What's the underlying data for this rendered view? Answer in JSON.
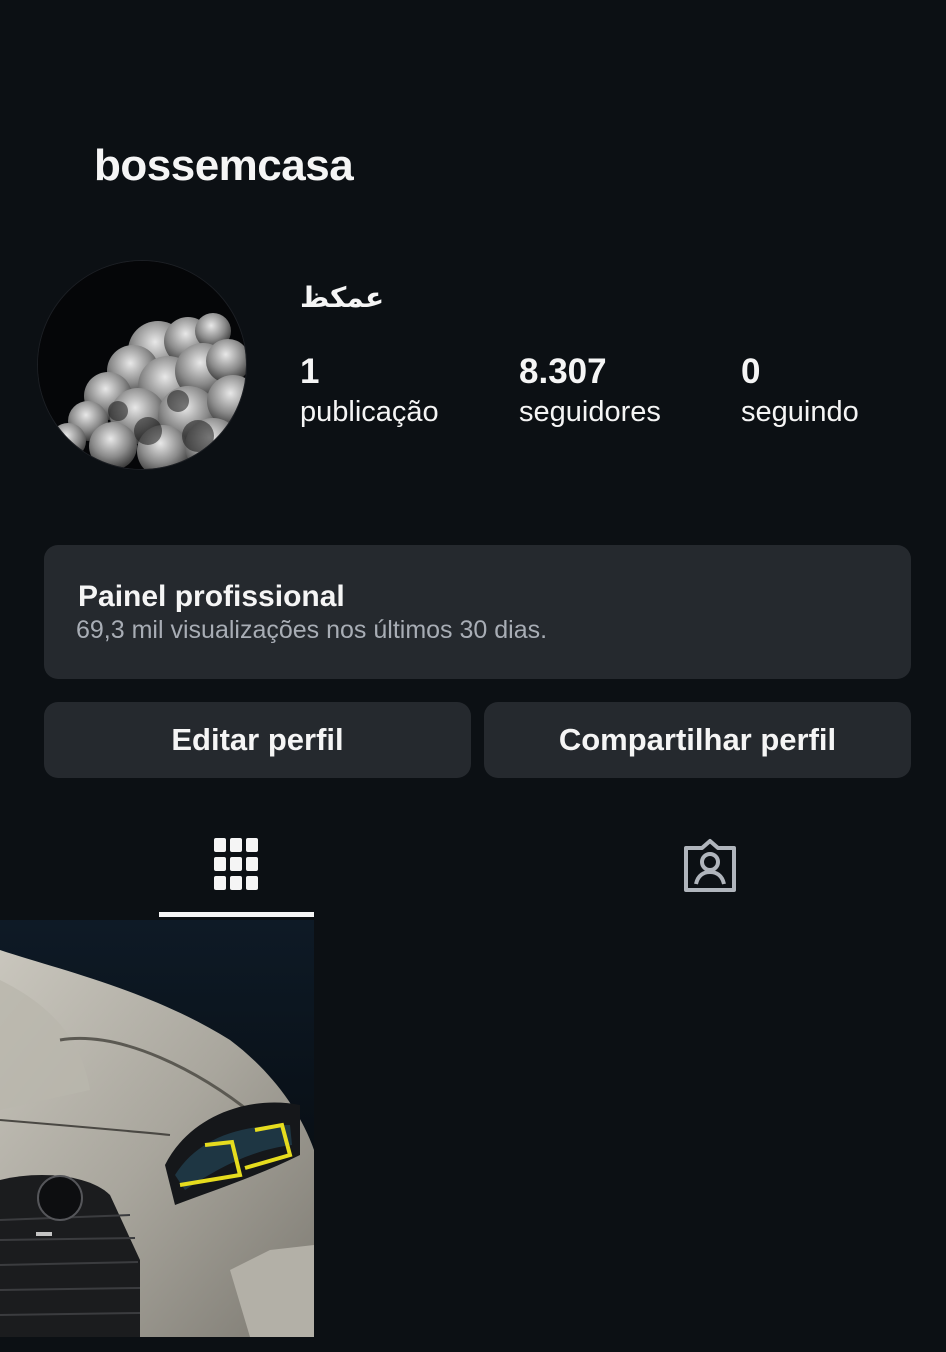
{
  "profile": {
    "username": "bossemcasa",
    "display_name": "عمكظ",
    "stats": {
      "posts_count": "1",
      "posts_label": "publicação",
      "followers_count": "8.307",
      "followers_label": "seguidores",
      "following_count": "0",
      "following_label": "seguindo"
    }
  },
  "dashboard": {
    "title": "Painel profissional",
    "subtitle": "69,3 mil visualizações nos últimos 30 dias."
  },
  "actions": {
    "edit_label": "Editar perfil",
    "share_label": "Compartilhar perfil"
  },
  "tabs": [
    {
      "icon": "grid-icon",
      "active": true
    },
    {
      "icon": "tagged-person-icon",
      "active": false
    }
  ],
  "posts": [
    {
      "subject": "car-front-photo"
    }
  ],
  "colors": {
    "background": "#0c1014",
    "surface": "#25292e",
    "text_primary": "#f5f5f5",
    "text_secondary": "#a8adb5",
    "headlight_accent": "#e6dc1e"
  }
}
